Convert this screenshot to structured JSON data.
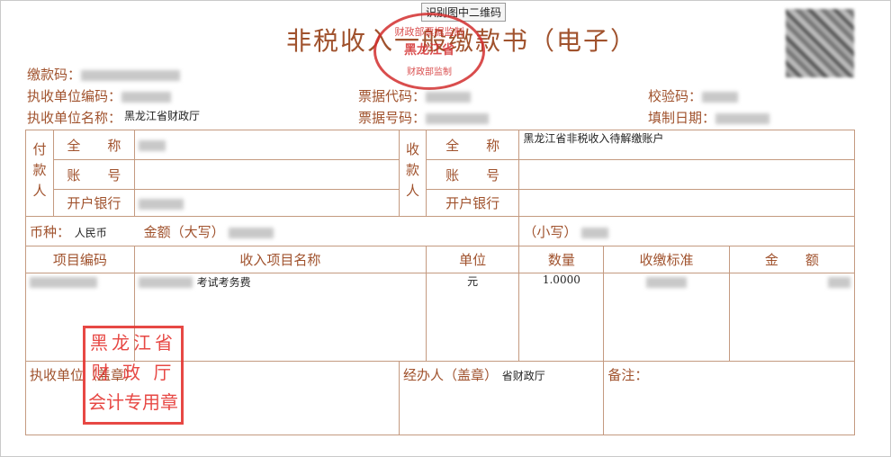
{
  "tooltip": "识别图中二维码",
  "title": "非税收入一般缴款书（电子）",
  "seal_round": {
    "line1": "财政部票据监制",
    "line2": "黑龙江省",
    "line3": "财政部监制"
  },
  "header": {
    "pay_code_label": "缴款码：",
    "unit_code_label": "执收单位编码：",
    "unit_name_label": "执收单位名称：",
    "unit_name_value": "黑龙江省财政厅",
    "bill_code_label": "票据代码：",
    "bill_no_label": "票据号码：",
    "check_code_label": "校验码：",
    "fill_date_label": "填制日期："
  },
  "payer": {
    "side_label": "付款人",
    "full_name_label": "全　　称",
    "account_label": "账　　号",
    "bank_label": "开户银行"
  },
  "payee": {
    "side_label": "收款人",
    "full_name_label": "全　　称",
    "full_name_value": "黑龙江省非税收入待解缴账户",
    "account_label": "账　　号",
    "bank_label": "开户银行"
  },
  "amount_row": {
    "currency_label": "币种：",
    "currency_value": "人民币",
    "amount_upper_label": "金额（大写）",
    "amount_lower_label": "（小写）"
  },
  "items_header": [
    "项目编码",
    "收入项目名称",
    "单位",
    "数量",
    "收缴标准",
    "金　　额"
  ],
  "items": [
    {
      "name": "考试考务费",
      "unit": "元",
      "quantity": "1.0000"
    }
  ],
  "footer": {
    "unit_seal_label": "执收单位（盖章）",
    "handler_label": "经办人（盖章）",
    "handler_value": "省财政厅",
    "note_label": "备注："
  },
  "seal_square": [
    "黑龙江省",
    "财 政 厅",
    "会计专用章"
  ]
}
